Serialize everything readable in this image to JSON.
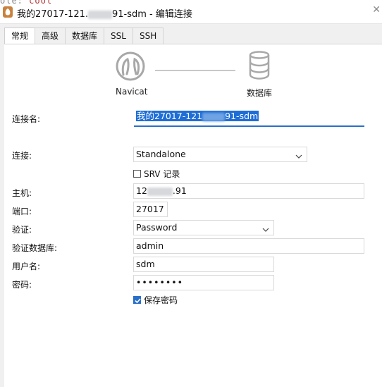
{
  "window": {
    "title": "我的27017-121.···.91-sdm - 编辑连接",
    "title_prefix": "我的27017-121.",
    "title_suffix": "91-sdm - 编辑连接",
    "close_glyph": "✕",
    "behind_text_a": "ole:",
    "behind_text_b": "cool"
  },
  "tabs": [
    {
      "label": "常规",
      "active": true
    },
    {
      "label": "高级",
      "active": false
    },
    {
      "label": "数据库",
      "active": false
    },
    {
      "label": "SSL",
      "active": false
    },
    {
      "label": "SSH",
      "active": false
    }
  ],
  "graphic": {
    "left_label": "Navicat",
    "right_label": "数据库"
  },
  "form": {
    "conn_name": {
      "label": "连接名:",
      "prefix": "我的27017-121",
      "suffix": "91-sdm"
    },
    "connection": {
      "label": "连接:",
      "value": "Standalone"
    },
    "srv": {
      "label": "SRV 记录",
      "checked": false
    },
    "host": {
      "label": "主机:",
      "prefix": "12",
      "suffix": ".91"
    },
    "port": {
      "label": "端口:",
      "value": "27017"
    },
    "auth": {
      "label": "验证:",
      "value": "Password"
    },
    "auth_db": {
      "label": "验证数据库:",
      "value": "admin"
    },
    "username": {
      "label": "用户名:",
      "value": "sdm"
    },
    "password": {
      "label": "密码:",
      "value": "••••••••"
    },
    "save_password": {
      "label": "保存密码",
      "checked": true
    }
  },
  "colors": {
    "accent": "#2a6fc9",
    "selection": "#1f6ed6"
  }
}
